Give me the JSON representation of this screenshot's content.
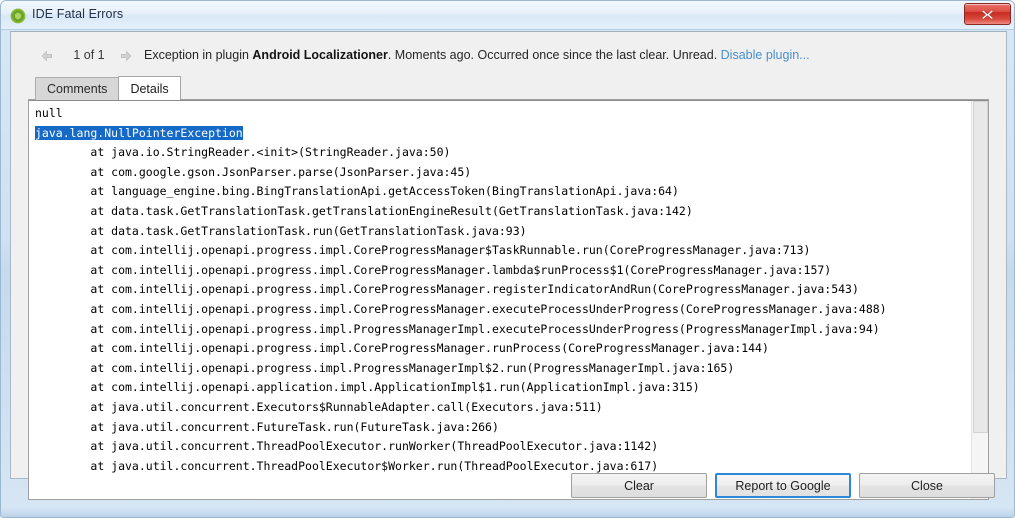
{
  "window": {
    "title": "IDE Fatal Errors",
    "icon": "android-studio-icon",
    "close_label": "×"
  },
  "infobar": {
    "counter": "1 of 1",
    "prev_icon": "arrow-left-icon",
    "next_icon": "arrow-right-icon",
    "message_prefix": "Exception in plugin ",
    "plugin_name": "Android Localizationer",
    "message_suffix": ". Moments ago. Occurred once since the last clear. Unread. ",
    "disable_link": "Disable plugin..."
  },
  "tabs": [
    {
      "label": "Comments",
      "selected": false
    },
    {
      "label": "Details",
      "selected": true
    }
  ],
  "trace": {
    "header": "null",
    "exception": "java.lang.NullPointerException",
    "lines": [
      "\tat java.io.StringReader.<init>(StringReader.java:50)",
      "\tat com.google.gson.JsonParser.parse(JsonParser.java:45)",
      "\tat language_engine.bing.BingTranslationApi.getAccessToken(BingTranslationApi.java:64)",
      "\tat data.task.GetTranslationTask.getTranslationEngineResult(GetTranslationTask.java:142)",
      "\tat data.task.GetTranslationTask.run(GetTranslationTask.java:93)",
      "\tat com.intellij.openapi.progress.impl.CoreProgressManager$TaskRunnable.run(CoreProgressManager.java:713)",
      "\tat com.intellij.openapi.progress.impl.CoreProgressManager.lambda$runProcess$1(CoreProgressManager.java:157)",
      "\tat com.intellij.openapi.progress.impl.CoreProgressManager.registerIndicatorAndRun(CoreProgressManager.java:543)",
      "\tat com.intellij.openapi.progress.impl.CoreProgressManager.executeProcessUnderProgress(CoreProgressManager.java:488)",
      "\tat com.intellij.openapi.progress.impl.ProgressManagerImpl.executeProcessUnderProgress(ProgressManagerImpl.java:94)",
      "\tat com.intellij.openapi.progress.impl.CoreProgressManager.runProcess(CoreProgressManager.java:144)",
      "\tat com.intellij.openapi.progress.impl.ProgressManagerImpl$2.run(ProgressManagerImpl.java:165)",
      "\tat com.intellij.openapi.application.impl.ApplicationImpl$1.run(ApplicationImpl.java:315)",
      "\tat java.util.concurrent.Executors$RunnableAdapter.call(Executors.java:511)",
      "\tat java.util.concurrent.FutureTask.run(FutureTask.java:266)",
      "\tat java.util.concurrent.ThreadPoolExecutor.runWorker(ThreadPoolExecutor.java:1142)",
      "\tat java.util.concurrent.ThreadPoolExecutor$Worker.run(ThreadPoolExecutor.java:617)"
    ]
  },
  "buttons": {
    "clear": "Clear",
    "report": "Report to Google",
    "close": "Close"
  },
  "colors": {
    "selection": "#1569c7",
    "link": "#4a8ecf",
    "default_button_border": "#2f87d8",
    "close_button": "#c62b21"
  }
}
